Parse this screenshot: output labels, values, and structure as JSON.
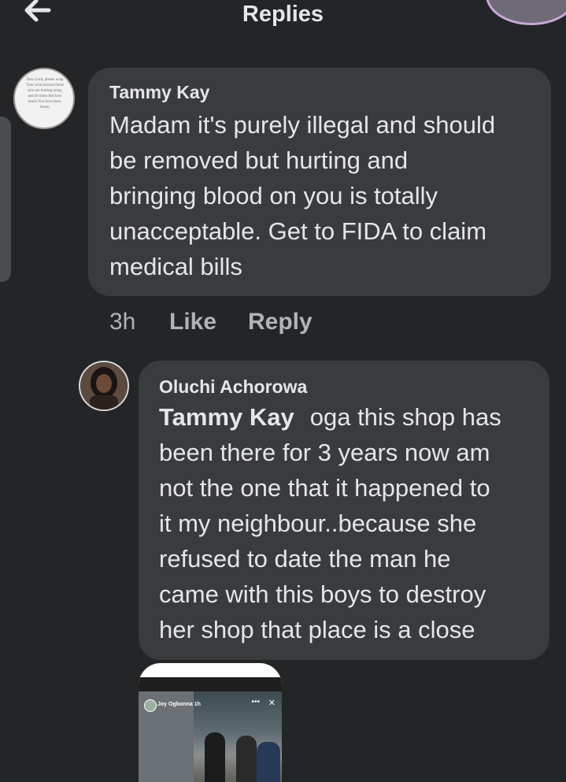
{
  "header": {
    "title": "Replies",
    "back_icon": "arrow-left-icon"
  },
  "comments": [
    {
      "author": "Tammy Kay",
      "avatar_quote": "Dear Lord, please wrap Your arms around those who are hurting today, and let them feel how much You love them. Amen.",
      "lines": [
        "Madam it's purely illegal and should",
        "be removed but hurting and",
        "bringing blood on you is totally",
        "unacceptable. Get to FIDA to claim",
        "medical bills"
      ],
      "time": "3h",
      "like_label": "Like",
      "reply_label": "Reply"
    },
    {
      "author": "Oluchi Achorowa",
      "mention": "Tammy Kay",
      "lines": [
        "oga this shop has",
        "been there for 3 years now am",
        "not the one that it happened to",
        "it my neighbour..because she",
        "refused to date the man he",
        "came with this boys to destroy",
        "her shop that place is a close"
      ]
    }
  ],
  "attachment": {
    "poster": "Joy Ogbonna",
    "posted_time": "1h",
    "menu_icon": "more-dots-icon",
    "close_icon": "close-icon"
  }
}
